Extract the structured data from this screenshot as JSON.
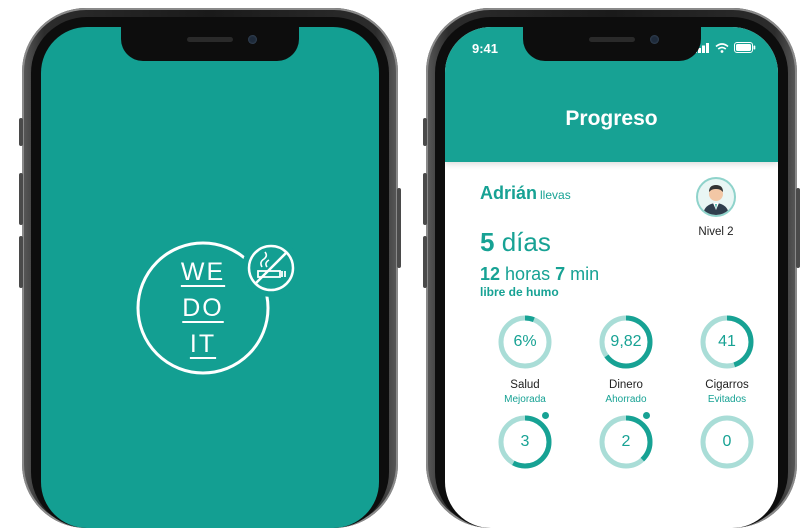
{
  "colors": {
    "teal": "#17a294",
    "teal_light": "#a9ddd7",
    "splash_bg": "#139f92"
  },
  "splash": {
    "logo_lines": [
      "WE",
      "DO",
      "IT"
    ],
    "badge_icon": "no-smoking-icon"
  },
  "app": {
    "status": {
      "time": "9:41",
      "icons": [
        "signal-icon",
        "wifi-icon",
        "battery-icon"
      ]
    },
    "header": {
      "title": "Progreso"
    },
    "user": {
      "name": "Adrián",
      "suffix": "llevas",
      "level": "Nivel 2",
      "avatar_icon": "user-avatar-icon"
    },
    "streak": {
      "days_value": "5",
      "days_unit": "días",
      "hours_value": "12",
      "hours_unit": "horas",
      "minutes_value": "7",
      "minutes_unit": "min",
      "caption": "libre de humo"
    },
    "gauges": [
      {
        "value": "6%",
        "label": "Salud",
        "sub": "Mejorada",
        "progress": 0.06
      },
      {
        "value": "9,82",
        "label": "Dinero",
        "sub": "Ahorrado",
        "progress": 0.65
      },
      {
        "value": "41",
        "label": "Cigarros",
        "sub": "Evitados",
        "progress": 0.45
      },
      {
        "value": "3",
        "label": "",
        "sub": "",
        "progress": 0.58,
        "dot": true
      },
      {
        "value": "2",
        "label": "",
        "sub": "",
        "progress": 0.38,
        "dot": true
      },
      {
        "value": "0",
        "label": "",
        "sub": "",
        "progress": 0.0
      }
    ]
  }
}
